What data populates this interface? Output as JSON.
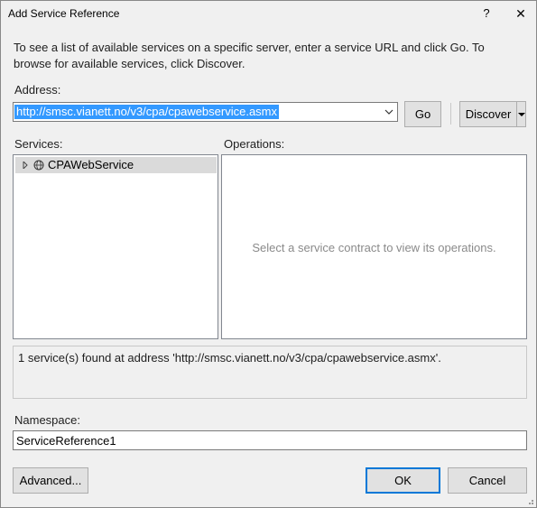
{
  "window": {
    "title": "Add Service Reference",
    "help_glyph": "?",
    "close_glyph": "✕"
  },
  "description": "To see a list of available services on a specific server, enter a service URL and click Go. To browse for available services, click Discover.",
  "address": {
    "label": "Address:",
    "value": "http://smsc.vianett.no/v3/cpa/cpawebservice.asmx"
  },
  "buttons": {
    "go": "Go",
    "discover": "Discover",
    "advanced": "Advanced...",
    "ok": "OK",
    "cancel": "Cancel"
  },
  "services": {
    "label": "Services:",
    "items": [
      {
        "label": "CPAWebService",
        "icon": "globe-icon",
        "selected": true
      }
    ]
  },
  "operations": {
    "label": "Operations:",
    "placeholder": "Select a service contract to view its operations."
  },
  "status": "1 service(s) found at address 'http://smsc.vianett.no/v3/cpa/cpawebservice.asmx'.",
  "namespace": {
    "label": "Namespace:",
    "value": "ServiceReference1"
  },
  "colors": {
    "dialog_bg": "#f0f0f0",
    "selection": "#3399ff",
    "default_button_border": "#0078d7",
    "tree_selection": "#dadada"
  }
}
